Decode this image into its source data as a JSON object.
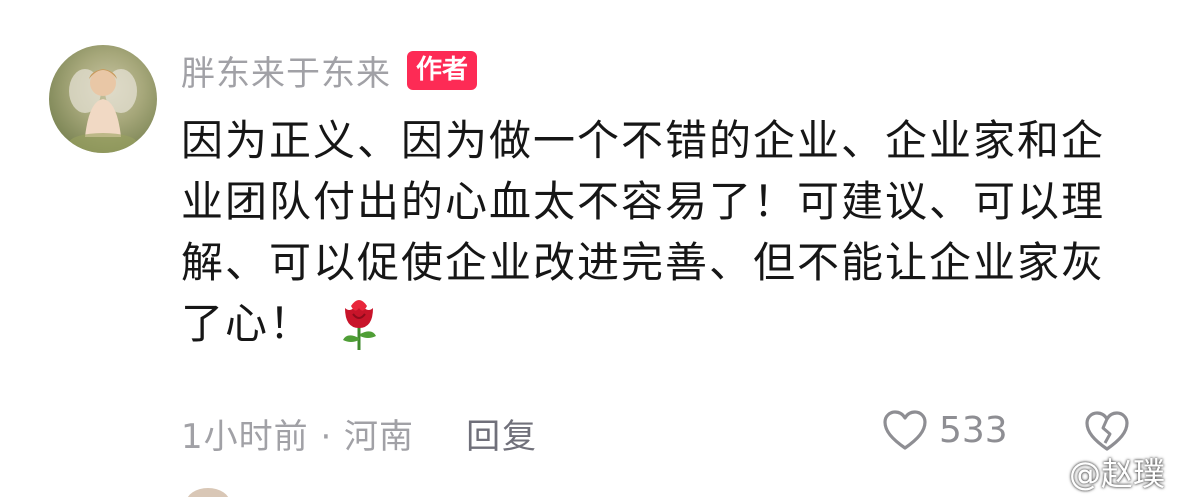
{
  "comment": {
    "username": "胖东来于东来",
    "author_badge": "作者",
    "text": "因为正义、因为做一个不错的企业、企业家和企业团队付出的心血太不容易了！可建议、可以理解、可以促使企业改进完善、但不能让企业家灰了心！",
    "emoji_icon": "rose-icon",
    "time_location": "1小时前 · 河南",
    "reply_label": "回复",
    "like_count": "533",
    "like_icon": "heart-outline-icon",
    "dislike_icon": "broken-heart-icon"
  },
  "watermark": {
    "text": "@赵璞",
    "icon": "weibo-logo-icon"
  },
  "colors": {
    "badge_bg": "#fd2b55",
    "muted_text": "#a1a1a6",
    "body_text": "#161616",
    "rose_red": "#d3152a"
  }
}
